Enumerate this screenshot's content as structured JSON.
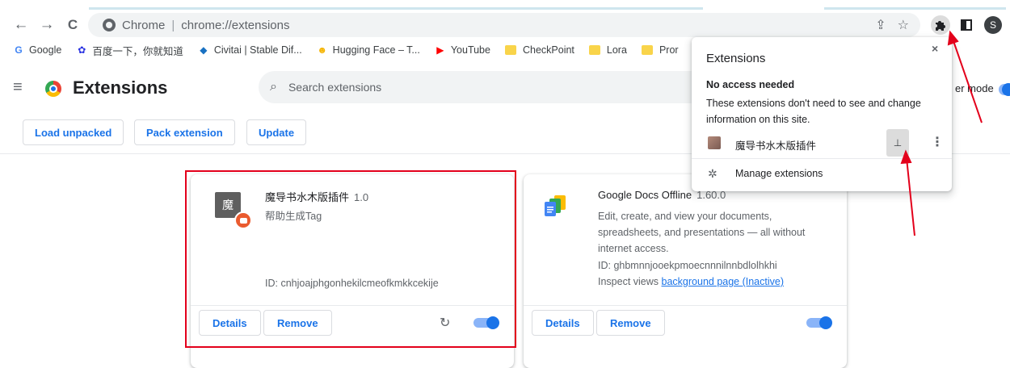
{
  "browser": {
    "omnibox": {
      "chrome_label": "Chrome",
      "separator": "|",
      "url": "chrome://extensions"
    },
    "profile_initial": "S",
    "nav": {
      "back": "←",
      "forward": "→",
      "reload": "C"
    }
  },
  "bookmarks": [
    {
      "label": "Google",
      "icon": "google-icon",
      "icon_text": "G",
      "color": "#4285f4"
    },
    {
      "label": "百度一下，你就知道",
      "icon": "baidu-icon",
      "icon_text": "✿",
      "color": "#2932e1"
    },
    {
      "label": "Civitai | Stable Dif...",
      "icon": "civitai-icon",
      "icon_text": "◆",
      "color": "#1971c2"
    },
    {
      "label": "Hugging Face – T...",
      "icon": "hugging-face-icon",
      "icon_text": "☻",
      "color": "#f5b400"
    },
    {
      "label": "YouTube",
      "icon": "youtube-icon",
      "icon_text": "▶",
      "color": "#ff0000"
    },
    {
      "label": "CheckPoint",
      "icon": "folder-icon"
    },
    {
      "label": "Lora",
      "icon": "folder-icon"
    },
    {
      "label": "Pror",
      "icon": "folder-icon"
    }
  ],
  "page": {
    "title": "Extensions",
    "search_placeholder": "Search extensions",
    "dev_mode_label": "er mode",
    "buttons": {
      "load_unpacked": "Load unpacked",
      "pack_extension": "Pack extension",
      "update": "Update"
    }
  },
  "extensions": [
    {
      "name": "魔导书水木版插件",
      "version": "1.0",
      "icon_text": "魔",
      "description": "帮助生成Tag",
      "id": "ID: cnhjoajphgonhekilcmeofkmkkcekije",
      "details_label": "Details",
      "remove_label": "Remove",
      "enabled": true
    },
    {
      "name": "Google Docs Offline",
      "version": "1.60.0",
      "description": "Edit, create, and view your documents, spreadsheets, and presentations — all without internet access.",
      "id": "ID: ghbmnnjooekpmoecnnnilnnbdlolhkhi",
      "inspect_prefix": "Inspect views",
      "inspect_link": "background page (Inactive)",
      "details_label": "Details",
      "remove_label": "Remove",
      "enabled": true
    }
  ],
  "popup": {
    "title": "Extensions",
    "close": "×",
    "section_title": "No access needed",
    "section_desc": "These extensions don't need to see and change information on this site.",
    "item_name": "魔导书水木版插件",
    "pin_glyph": "⊥",
    "more_glyph": "⋮",
    "manage_label": "Manage extensions"
  },
  "colors": {
    "accent": "#1a73e8",
    "annotation": "#e3001b"
  }
}
